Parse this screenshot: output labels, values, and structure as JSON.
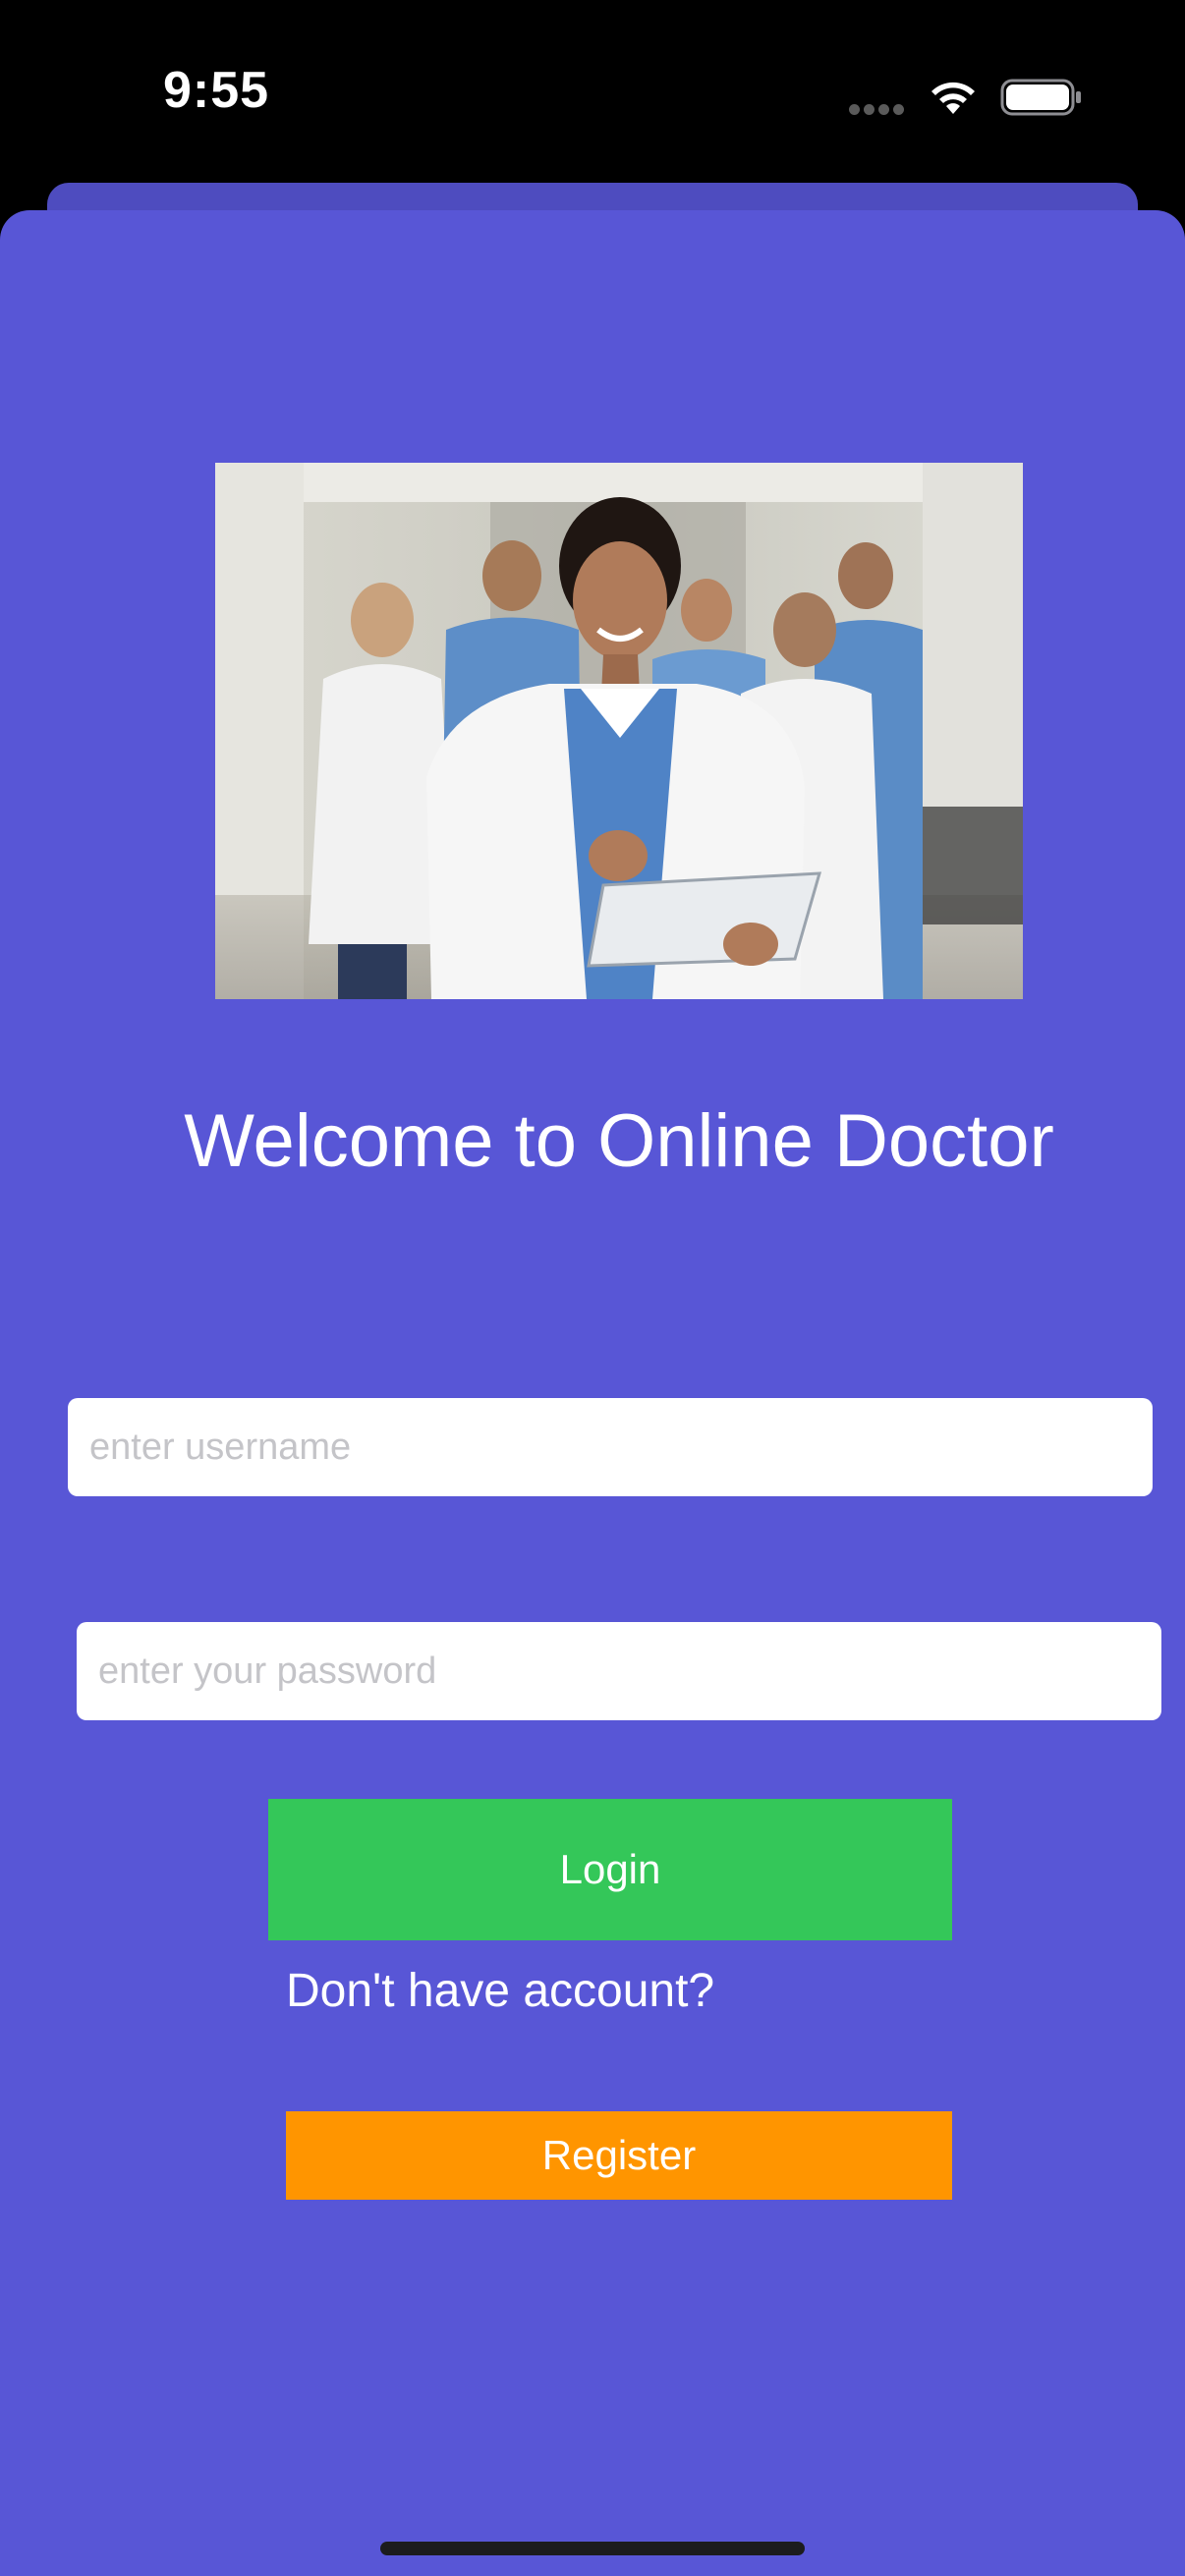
{
  "status_bar": {
    "time": "9:55"
  },
  "login": {
    "title": "Welcome to Online Doctor",
    "username_placeholder": "enter username",
    "password_placeholder": "enter your password",
    "login_label": "Login",
    "no_account_text": "Don't have account?",
    "register_label": "Register"
  },
  "colors": {
    "background": "#5856d6",
    "login_button": "#34c759",
    "register_button": "#ff9500"
  },
  "icons": {
    "wifi": "wifi-icon",
    "battery": "battery-icon",
    "signal": "cellular-signal-icon"
  }
}
